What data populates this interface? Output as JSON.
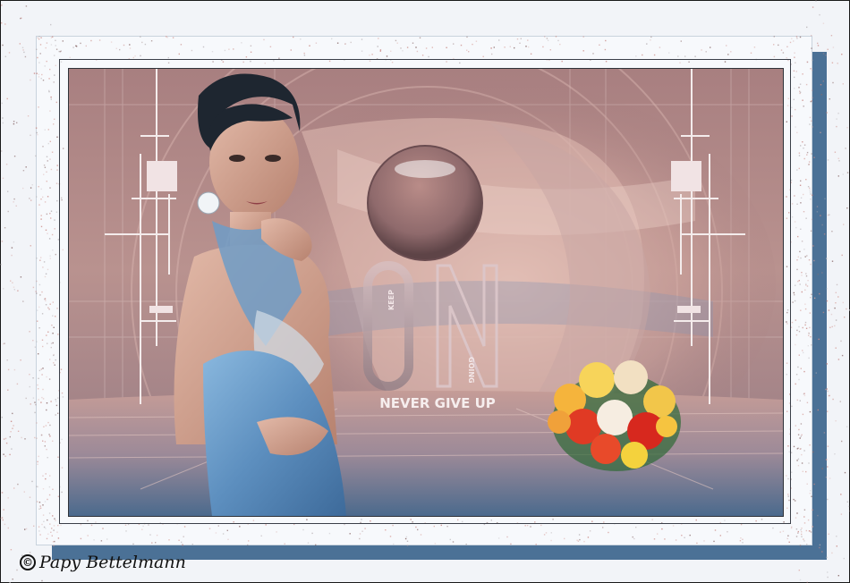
{
  "artwork": {
    "headline_small_top": "KEEP",
    "headline_big": "ON",
    "headline_small_side": "GOING",
    "tagline": "NEVER GIVE UP"
  },
  "credit": {
    "symbol": "©",
    "author": "Papy Bettelmann"
  },
  "colors": {
    "frame": "#f7f9fc",
    "frame_shadow": "#4b7196",
    "art_dusty_rose": "#b58a88",
    "art_blue": "#4a6d90",
    "dress_blue": "#6a9bc9"
  }
}
